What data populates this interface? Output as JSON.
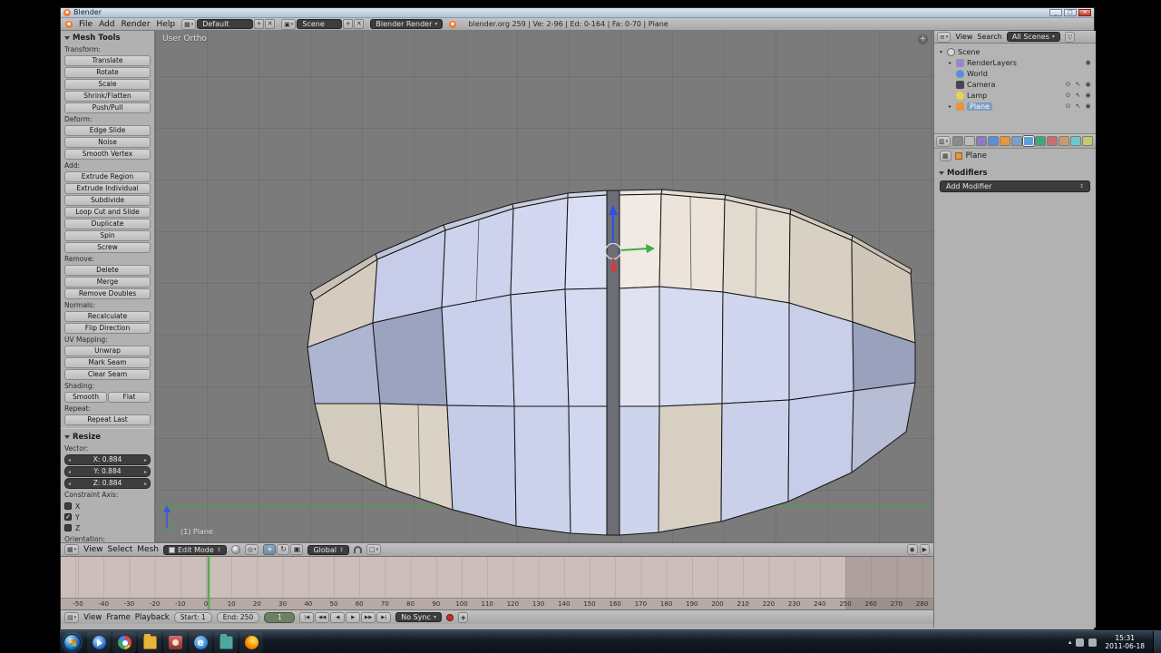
{
  "window": {
    "title": "Blender"
  },
  "infobar": {
    "menus": [
      "File",
      "Add",
      "Render",
      "Help"
    ],
    "layout_value": "Default",
    "scene_value": "Scene",
    "engine_value": "Blender Render",
    "stats": "blender.org 259 | Ve: 2-96 | Ed: 0-164 | Fa: 0-70 | Plane"
  },
  "toolshelf": {
    "title": "Mesh Tools",
    "sections": [
      {
        "label": "Transform:",
        "buttons": [
          "Translate",
          "Rotate",
          "Scale",
          "Shrink/Flatten",
          "Push/Pull"
        ]
      },
      {
        "label": "Deform:",
        "buttons": [
          "Edge Slide",
          "Noise",
          "Smooth Vertex"
        ]
      },
      {
        "label": "Add:",
        "buttons": [
          "Extrude Region",
          "Extrude Individual",
          "Subdivide",
          "Loop Cut and Slide",
          "Duplicate",
          "Spin",
          "Screw"
        ]
      },
      {
        "label": "Remove:",
        "buttons": [
          "Delete",
          "Merge",
          "Remove Doubles"
        ]
      },
      {
        "label": "Normals:",
        "buttons": [
          "Recalculate",
          "Flip Direction"
        ]
      },
      {
        "label": "UV Mapping:",
        "buttons": [
          "Unwrap",
          "Mark Seam",
          "Clear Seam"
        ]
      },
      {
        "label": "Shading:",
        "row_buttons": [
          "Smooth",
          "Flat"
        ]
      },
      {
        "label": "Repeat:",
        "buttons": [
          "Repeat Last"
        ]
      }
    ],
    "operator": {
      "title": "Resize",
      "vector_label": "Vector:",
      "fields": [
        {
          "label": "X: 0.884"
        },
        {
          "label": "Y: 0.884"
        },
        {
          "label": "Z: 0.884"
        }
      ],
      "constraint_label": "Constraint Axis:",
      "axes": [
        {
          "label": "X",
          "checked": false
        },
        {
          "label": "Y",
          "checked": true
        },
        {
          "label": "Z",
          "checked": false
        }
      ],
      "orientation_label": "Orientation:"
    }
  },
  "viewport": {
    "view_label": "User Ortho",
    "object_label": "(1) Plane",
    "header": {
      "menus": [
        "View",
        "Select",
        "Mesh"
      ],
      "mode": "Edit Mode",
      "orientation": "Global"
    }
  },
  "outliner": {
    "header": {
      "menus": [
        "View",
        "Search"
      ],
      "filter": "All Scenes"
    },
    "rows": [
      {
        "label": "Scene",
        "icon": "scene-icon",
        "expander": "▾",
        "indent": 0,
        "right": [],
        "selected": false
      },
      {
        "label": "RenderLayers",
        "icon": "renderlayers-icon",
        "expander": "▸",
        "indent": 1,
        "right": [
          "camera"
        ],
        "selected": false
      },
      {
        "label": "World",
        "icon": "world-icon",
        "expander": "",
        "indent": 1,
        "right": [],
        "selected": false
      },
      {
        "label": "Camera",
        "icon": "camera-icon",
        "expander": "",
        "indent": 1,
        "right": [
          "eye",
          "cursor",
          "camera"
        ],
        "selected": false
      },
      {
        "label": "Lamp",
        "icon": "lamp-icon",
        "expander": "",
        "indent": 1,
        "right": [
          "eye",
          "cursor",
          "camera"
        ],
        "selected": false
      },
      {
        "label": "Plane",
        "icon": "mesh-icon",
        "expander": "▸",
        "indent": 1,
        "right": [
          "eye",
          "cursor",
          "camera"
        ],
        "selected": true
      }
    ]
  },
  "properties": {
    "tabs": [
      "render",
      "scene",
      "render-layers",
      "world",
      "object",
      "constraints",
      "modifiers",
      "data",
      "material",
      "texture",
      "particles",
      "physics"
    ],
    "active_tab": "modifiers",
    "breadcrumb": "Plane",
    "panel_title": "Modifiers",
    "add_modifier_label": "Add Modifier"
  },
  "timeline": {
    "menus": [
      "View",
      "Frame",
      "Playback"
    ],
    "start_label": "Start: 1",
    "end_label": "End: 250",
    "frame_value": "1",
    "sync_label": "No Sync",
    "ruler": [
      -50,
      -40,
      -30,
      -20,
      -10,
      0,
      10,
      20,
      30,
      40,
      50,
      60,
      70,
      80,
      90,
      100,
      110,
      120,
      130,
      140,
      150,
      160,
      170,
      180,
      190,
      200,
      210,
      220,
      230,
      240,
      250,
      260,
      270,
      280
    ]
  },
  "taskbar": {
    "apps": [
      "windows-media-player",
      "google-chrome",
      "file-explorer",
      "photo-viewer",
      "internet-explorer",
      "folder",
      "firefox"
    ],
    "time": "15:31",
    "date": "2011-06-18"
  }
}
